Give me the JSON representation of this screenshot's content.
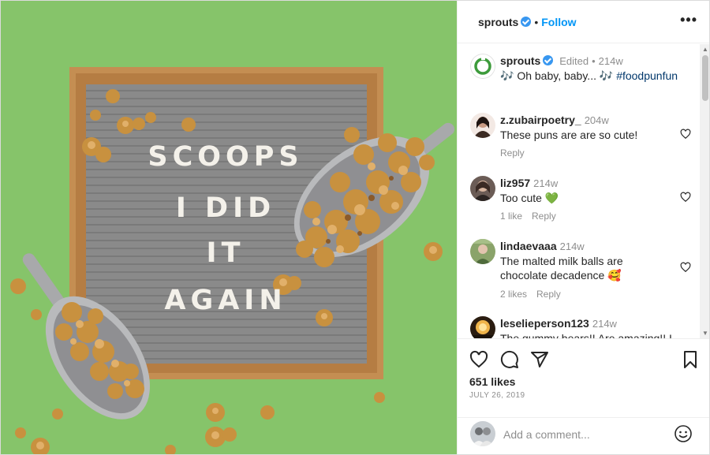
{
  "post": {
    "author": "sprouts",
    "follow_label": "Follow",
    "more_label": "•••",
    "board_lines": [
      "SCOOPS",
      "I DID",
      "IT",
      "AGAIN"
    ],
    "caption": {
      "user": "sprouts",
      "edited": "Edited",
      "time": "214w",
      "text": "🎶 Oh baby, baby... 🎶 ",
      "hashtag": "#foodpunfun"
    },
    "likes": "651 likes",
    "date": "JULY 26, 2019"
  },
  "comments": [
    {
      "user": "z.zubairpoetry_",
      "time": "204w",
      "text": "These puns are are so cute!",
      "likes": "",
      "reply_label": "Reply",
      "avatar_color": "#3b2a22"
    },
    {
      "user": "liz957",
      "time": "214w",
      "text": "Too cute 💚",
      "likes": "1 like",
      "reply_label": "Reply",
      "avatar_color": "#5a4a44"
    },
    {
      "user": "lindaevaaa",
      "time": "214w",
      "text": "The malted milk balls are chocolate decadence 🥰",
      "likes": "2 likes",
      "reply_label": "Reply",
      "avatar_color": "#4f6b3c"
    },
    {
      "user": "leselieperson123",
      "time": "214w",
      "text": "The gummy bears!! Are amazing!! I",
      "likes": "",
      "reply_label": "",
      "avatar_color": "#d7a04a"
    }
  ],
  "add_comment": {
    "placeholder": "Add a comment..."
  },
  "colors": {
    "accent": "#0095f6",
    "verified": "#3897f0",
    "background_green": "#86c46a"
  },
  "icons": {
    "like": "heart-icon",
    "comment": "comment-icon",
    "share": "paper-plane-icon",
    "save": "bookmark-icon",
    "emoji": "emoji-icon"
  }
}
